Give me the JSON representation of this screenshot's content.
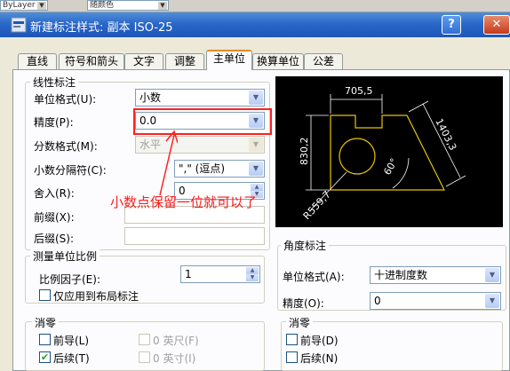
{
  "toolbar": {
    "layer_combo": "ByLayer",
    "color_combo": "随颜色"
  },
  "window": {
    "title": "新建标注样式: 副本 ISO-25",
    "help": "?",
    "close": "✕"
  },
  "tabs": [
    {
      "label": "直线"
    },
    {
      "label": "符号和箭头"
    },
    {
      "label": "文字"
    },
    {
      "label": "调整"
    },
    {
      "label": "主单位"
    },
    {
      "label": "换算单位"
    },
    {
      "label": "公差"
    }
  ],
  "linear": {
    "group_label": "线性标注",
    "unit_format_label": "单位格式(U):",
    "unit_format_value": "小数",
    "precision_label": "精度(P):",
    "precision_value": "0.0",
    "fraction_label": "分数格式(M):",
    "fraction_value": "水平",
    "decimal_sep_label": "小数分隔符(C):",
    "decimal_sep_value": "\",\" (逗点)",
    "round_label": "舍入(R):",
    "round_value": "0",
    "prefix_label": "前缀(X):",
    "suffix_label": "后缀(S):"
  },
  "scale": {
    "group_label": "测量单位比例",
    "factor_label": "比例因子(E):",
    "factor_value": "1",
    "layout_only_label": "仅应用到布局标注"
  },
  "zero_linear": {
    "group_label": "消零",
    "leading_label": "前导(L)",
    "trailing_label": "后续(T)",
    "feet_label": "0 英尺(F)",
    "inches_label": "0 英寸(I)",
    "trailing_checked": "✔"
  },
  "angular": {
    "group_label": "角度标注",
    "unit_format_label": "单位格式(A):",
    "unit_format_value": "十进制度数",
    "precision_label": "精度(O):",
    "precision_value": "0"
  },
  "zero_angular": {
    "group_label": "消零",
    "leading_label": "前导(D)",
    "trailing_label": "后续(N)"
  },
  "preview": {
    "dim_top": "705,5",
    "dim_left": "830,2",
    "dim_right": "1403,3",
    "dim_angle": "60°",
    "dim_radius": "R559,7"
  },
  "annotation": {
    "text": "小数点保留一位就可以了"
  },
  "colors": {
    "accent": "#2a67c9",
    "annotation": "#ff1a1a",
    "preview_lines": "#e6c400"
  }
}
